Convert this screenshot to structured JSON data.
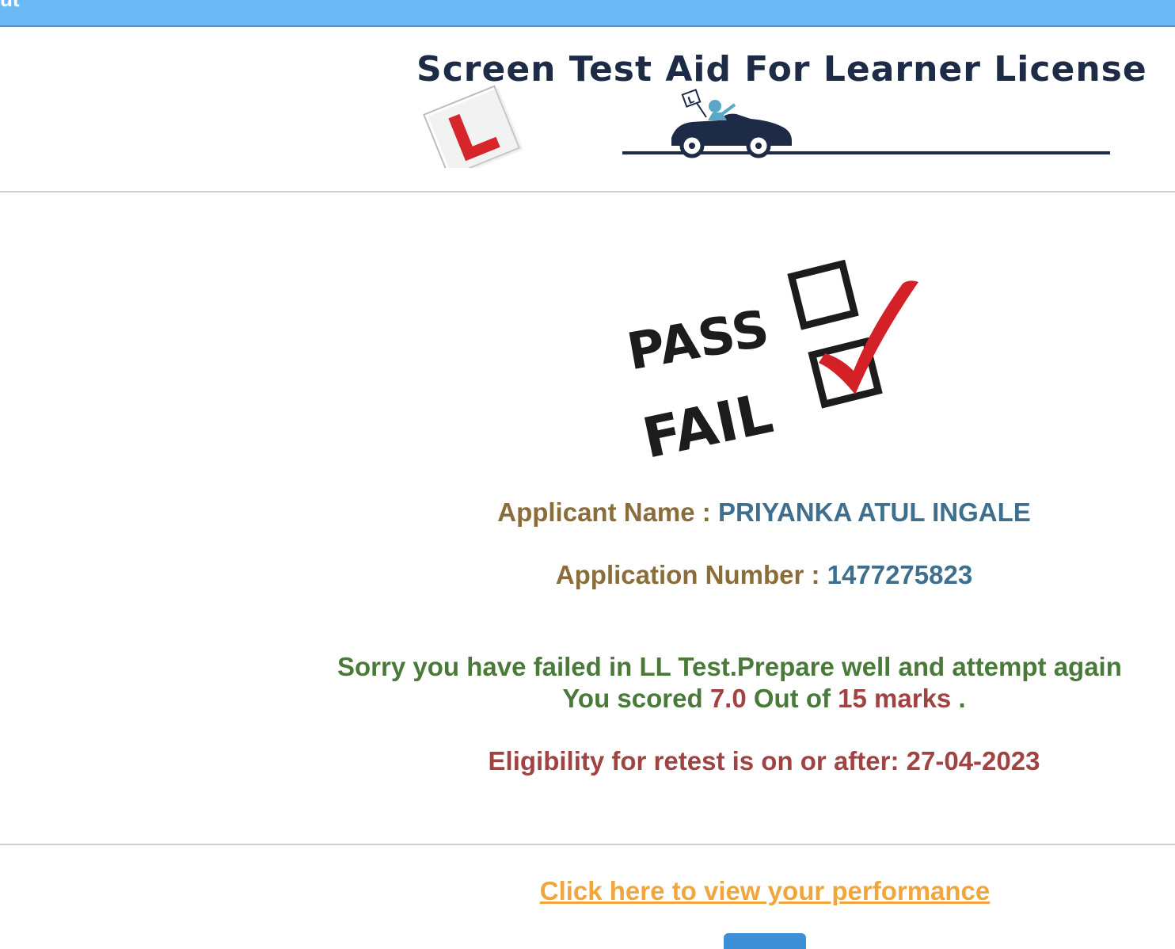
{
  "topbar": {
    "partial_text": "ut"
  },
  "header": {
    "logo_title": "Screen Test Aid For Learner License",
    "logo_colors": {
      "title": "#1d2b47",
      "l_plate_red": "#d7262b",
      "car": "#1d2b47",
      "driver": "#5aa7c7"
    }
  },
  "result_image": {
    "pass_label": "PASS",
    "fail_label": "FAIL",
    "check_color": "#d42027"
  },
  "applicant": {
    "name_label": "Applicant Name : ",
    "name_value": "PRIYANKA ATUL INGALE",
    "number_label": "Application Number : ",
    "number_value": "1477275823"
  },
  "result": {
    "message": "Sorry you have failed in LL Test.Prepare well and attempt again",
    "score_prefix": "You scored ",
    "score_value": "7.0",
    "score_mid": " Out of ",
    "score_total": "15 marks",
    "score_suffix": " .",
    "retest_label": "Eligibility for retest is on or after: ",
    "retest_date": "27-04-2023"
  },
  "actions": {
    "performance_link": "Click here to view your performance"
  },
  "colors": {
    "topbar": "#6bbaf5",
    "label_brown": "#8a6d3b",
    "value_blue": "#3f6f8e",
    "message_green": "#4a7a3a",
    "alert_red": "#a04343",
    "link_orange": "#f0a63c",
    "button_blue": "#3d8fd6"
  }
}
